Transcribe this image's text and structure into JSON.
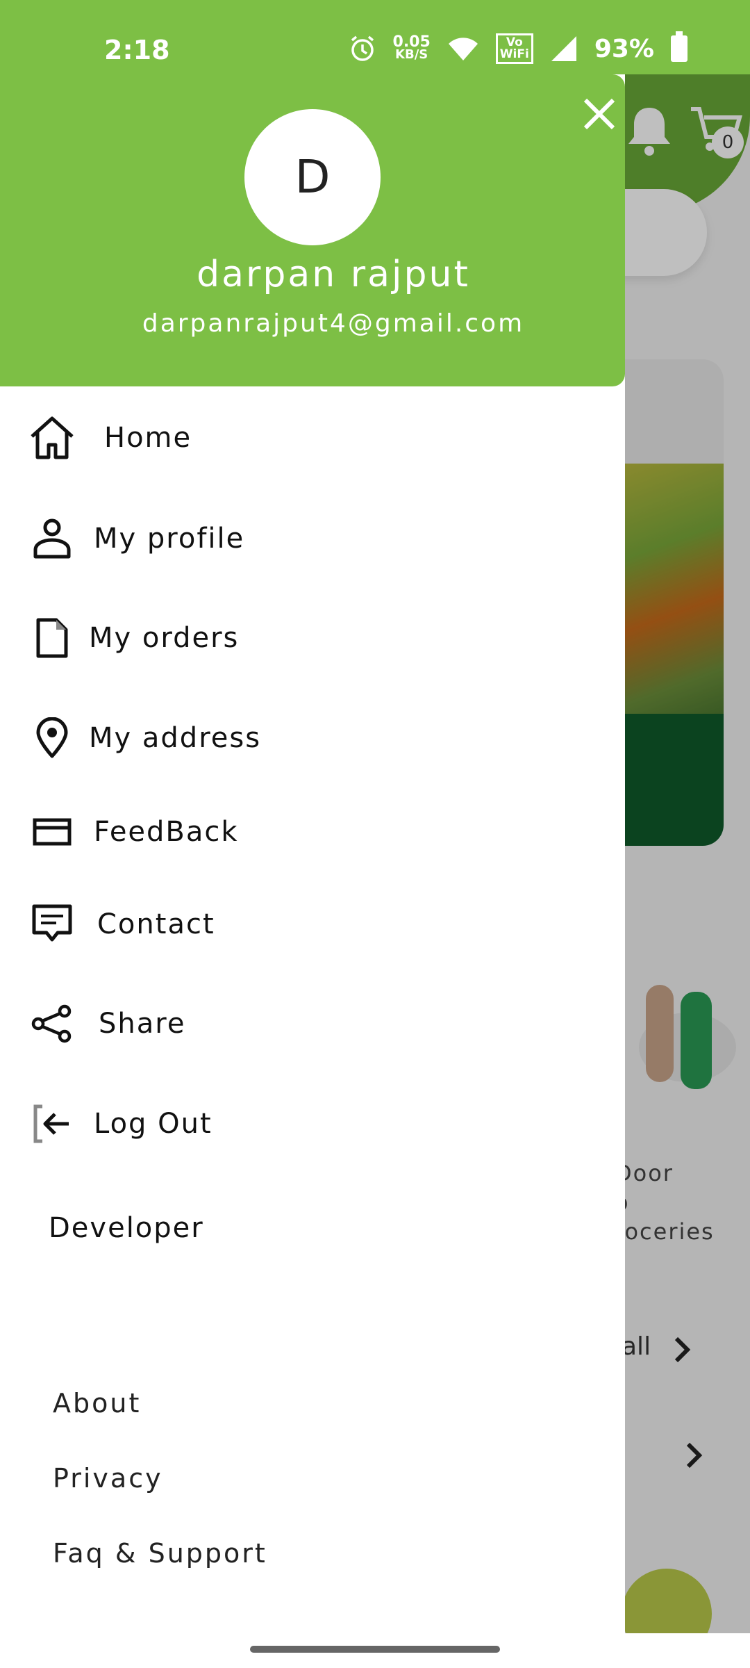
{
  "status_bar": {
    "time": "2:18",
    "net_speed_value": "0.05",
    "net_speed_unit": "KB/S",
    "vowifi_top": "Vo",
    "vowifi_bottom": "WiFi",
    "battery": "93%"
  },
  "background": {
    "cart_count": "0",
    "text_lines": [
      "Door",
      "o",
      "roceries"
    ],
    "see_all": "all"
  },
  "drawer": {
    "avatar_initial": "D",
    "user_name": "darpan rajput",
    "user_email": "darpanrajput4@gmail.com",
    "menu": [
      {
        "label": "Home",
        "icon": "home-icon"
      },
      {
        "label": "My profile",
        "icon": "person-icon"
      },
      {
        "label": "My orders",
        "icon": "document-icon"
      },
      {
        "label": "My address",
        "icon": "location-pin-icon"
      },
      {
        "label": "FeedBack",
        "icon": "feedback-icon"
      },
      {
        "label": "Contact",
        "icon": "message-icon"
      },
      {
        "label": "Share",
        "icon": "share-icon"
      },
      {
        "label": "Log Out",
        "icon": "logout-icon"
      }
    ],
    "developer_label": "Developer",
    "footer_links": [
      "About",
      "Privacy",
      "Faq & Support"
    ]
  },
  "colors": {
    "header_green": "#7dbf45",
    "background_green": "#69a937"
  }
}
